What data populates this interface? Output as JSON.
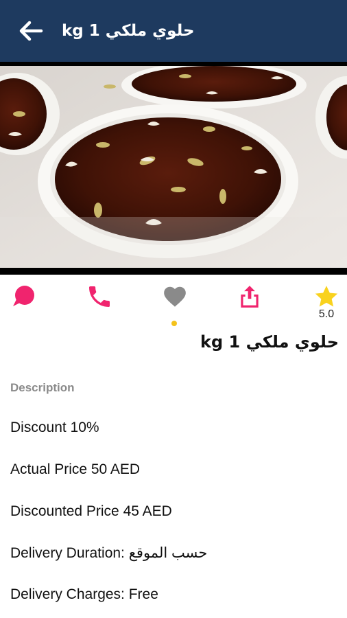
{
  "header": {
    "title": "حلوي ملكي 1 kg",
    "back_icon": "arrow-left-icon",
    "background": "#1e3a5f"
  },
  "hero": {
    "image_desc": "product-photo",
    "pager_dot_color": "#f4c21b"
  },
  "actions": {
    "chat_icon": "chat-bubble-icon",
    "call_icon": "phone-icon",
    "favorite_icon": "heart-icon",
    "share_icon": "share-icon",
    "rating_icon": "star-icon",
    "rating_value": "5.0",
    "accent_color": "#f0246e"
  },
  "product": {
    "title": "حلوي ملكي 1 kg"
  },
  "details": {
    "description_label": "Description",
    "discount": "Discount 10%",
    "actual_price": "Actual Price 50 AED",
    "discounted_price": "Discounted Price 45 AED",
    "delivery_duration": "Delivery Duration: حسب الموقع",
    "delivery_charges": "Delivery Charges: Free"
  }
}
